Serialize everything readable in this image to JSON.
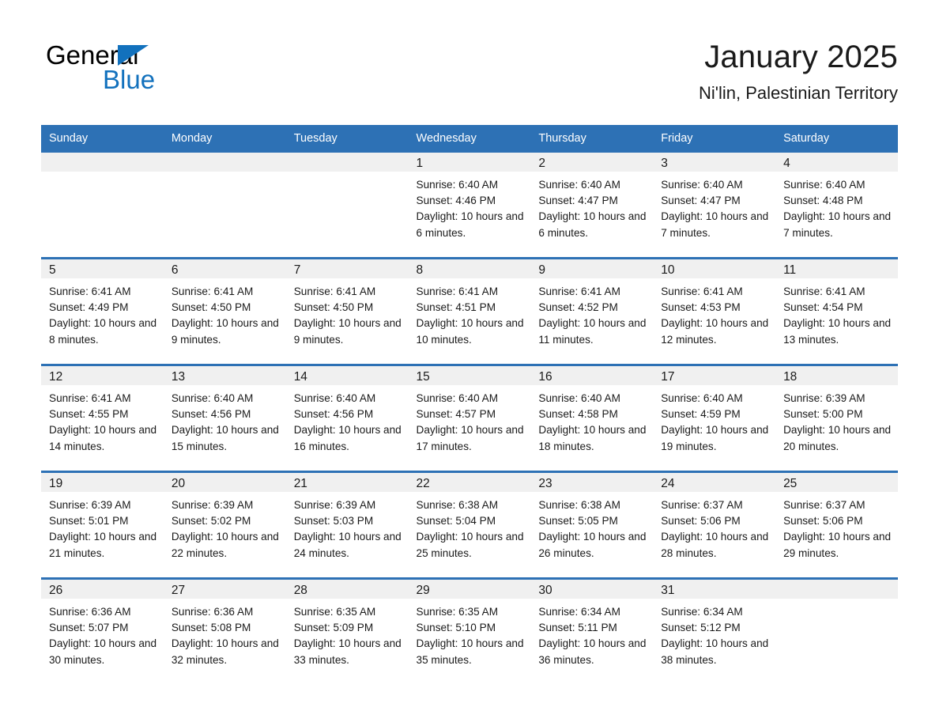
{
  "brand": {
    "line1": "General",
    "line2": "Blue",
    "triangle_color": "#1271bd",
    "text_color": "#000000"
  },
  "header": {
    "title": "January 2025",
    "subtitle": "Ni'lin, Palestinian Territory"
  },
  "theme": {
    "header_blue": "#2d71b5",
    "daynum_band": "#f0f0f0",
    "divider_blue": "#2d71b5",
    "page_background": "#ffffff"
  },
  "weekday_headers": [
    "Sunday",
    "Monday",
    "Tuesday",
    "Wednesday",
    "Thursday",
    "Friday",
    "Saturday"
  ],
  "weeks": [
    [
      {
        "day": "",
        "empty": true
      },
      {
        "day": "",
        "empty": true
      },
      {
        "day": "",
        "empty": true
      },
      {
        "day": "1",
        "sunrise": "Sunrise: 6:40 AM",
        "sunset": "Sunset: 4:46 PM",
        "daylight": "Daylight: 10 hours and 6 minutes."
      },
      {
        "day": "2",
        "sunrise": "Sunrise: 6:40 AM",
        "sunset": "Sunset: 4:47 PM",
        "daylight": "Daylight: 10 hours and 6 minutes."
      },
      {
        "day": "3",
        "sunrise": "Sunrise: 6:40 AM",
        "sunset": "Sunset: 4:47 PM",
        "daylight": "Daylight: 10 hours and 7 minutes."
      },
      {
        "day": "4",
        "sunrise": "Sunrise: 6:40 AM",
        "sunset": "Sunset: 4:48 PM",
        "daylight": "Daylight: 10 hours and 7 minutes."
      }
    ],
    [
      {
        "day": "5",
        "sunrise": "Sunrise: 6:41 AM",
        "sunset": "Sunset: 4:49 PM",
        "daylight": "Daylight: 10 hours and 8 minutes."
      },
      {
        "day": "6",
        "sunrise": "Sunrise: 6:41 AM",
        "sunset": "Sunset: 4:50 PM",
        "daylight": "Daylight: 10 hours and 9 minutes."
      },
      {
        "day": "7",
        "sunrise": "Sunrise: 6:41 AM",
        "sunset": "Sunset: 4:50 PM",
        "daylight": "Daylight: 10 hours and 9 minutes."
      },
      {
        "day": "8",
        "sunrise": "Sunrise: 6:41 AM",
        "sunset": "Sunset: 4:51 PM",
        "daylight": "Daylight: 10 hours and 10 minutes."
      },
      {
        "day": "9",
        "sunrise": "Sunrise: 6:41 AM",
        "sunset": "Sunset: 4:52 PM",
        "daylight": "Daylight: 10 hours and 11 minutes."
      },
      {
        "day": "10",
        "sunrise": "Sunrise: 6:41 AM",
        "sunset": "Sunset: 4:53 PM",
        "daylight": "Daylight: 10 hours and 12 minutes."
      },
      {
        "day": "11",
        "sunrise": "Sunrise: 6:41 AM",
        "sunset": "Sunset: 4:54 PM",
        "daylight": "Daylight: 10 hours and 13 minutes."
      }
    ],
    [
      {
        "day": "12",
        "sunrise": "Sunrise: 6:41 AM",
        "sunset": "Sunset: 4:55 PM",
        "daylight": "Daylight: 10 hours and 14 minutes."
      },
      {
        "day": "13",
        "sunrise": "Sunrise: 6:40 AM",
        "sunset": "Sunset: 4:56 PM",
        "daylight": "Daylight: 10 hours and 15 minutes."
      },
      {
        "day": "14",
        "sunrise": "Sunrise: 6:40 AM",
        "sunset": "Sunset: 4:56 PM",
        "daylight": "Daylight: 10 hours and 16 minutes."
      },
      {
        "day": "15",
        "sunrise": "Sunrise: 6:40 AM",
        "sunset": "Sunset: 4:57 PM",
        "daylight": "Daylight: 10 hours and 17 minutes."
      },
      {
        "day": "16",
        "sunrise": "Sunrise: 6:40 AM",
        "sunset": "Sunset: 4:58 PM",
        "daylight": "Daylight: 10 hours and 18 minutes."
      },
      {
        "day": "17",
        "sunrise": "Sunrise: 6:40 AM",
        "sunset": "Sunset: 4:59 PM",
        "daylight": "Daylight: 10 hours and 19 minutes."
      },
      {
        "day": "18",
        "sunrise": "Sunrise: 6:39 AM",
        "sunset": "Sunset: 5:00 PM",
        "daylight": "Daylight: 10 hours and 20 minutes."
      }
    ],
    [
      {
        "day": "19",
        "sunrise": "Sunrise: 6:39 AM",
        "sunset": "Sunset: 5:01 PM",
        "daylight": "Daylight: 10 hours and 21 minutes."
      },
      {
        "day": "20",
        "sunrise": "Sunrise: 6:39 AM",
        "sunset": "Sunset: 5:02 PM",
        "daylight": "Daylight: 10 hours and 22 minutes."
      },
      {
        "day": "21",
        "sunrise": "Sunrise: 6:39 AM",
        "sunset": "Sunset: 5:03 PM",
        "daylight": "Daylight: 10 hours and 24 minutes."
      },
      {
        "day": "22",
        "sunrise": "Sunrise: 6:38 AM",
        "sunset": "Sunset: 5:04 PM",
        "daylight": "Daylight: 10 hours and 25 minutes."
      },
      {
        "day": "23",
        "sunrise": "Sunrise: 6:38 AM",
        "sunset": "Sunset: 5:05 PM",
        "daylight": "Daylight: 10 hours and 26 minutes."
      },
      {
        "day": "24",
        "sunrise": "Sunrise: 6:37 AM",
        "sunset": "Sunset: 5:06 PM",
        "daylight": "Daylight: 10 hours and 28 minutes."
      },
      {
        "day": "25",
        "sunrise": "Sunrise: 6:37 AM",
        "sunset": "Sunset: 5:06 PM",
        "daylight": "Daylight: 10 hours and 29 minutes."
      }
    ],
    [
      {
        "day": "26",
        "sunrise": "Sunrise: 6:36 AM",
        "sunset": "Sunset: 5:07 PM",
        "daylight": "Daylight: 10 hours and 30 minutes."
      },
      {
        "day": "27",
        "sunrise": "Sunrise: 6:36 AM",
        "sunset": "Sunset: 5:08 PM",
        "daylight": "Daylight: 10 hours and 32 minutes."
      },
      {
        "day": "28",
        "sunrise": "Sunrise: 6:35 AM",
        "sunset": "Sunset: 5:09 PM",
        "daylight": "Daylight: 10 hours and 33 minutes."
      },
      {
        "day": "29",
        "sunrise": "Sunrise: 6:35 AM",
        "sunset": "Sunset: 5:10 PM",
        "daylight": "Daylight: 10 hours and 35 minutes."
      },
      {
        "day": "30",
        "sunrise": "Sunrise: 6:34 AM",
        "sunset": "Sunset: 5:11 PM",
        "daylight": "Daylight: 10 hours and 36 minutes."
      },
      {
        "day": "31",
        "sunrise": "Sunrise: 6:34 AM",
        "sunset": "Sunset: 5:12 PM",
        "daylight": "Daylight: 10 hours and 38 minutes."
      },
      {
        "day": "",
        "empty": true
      }
    ]
  ]
}
